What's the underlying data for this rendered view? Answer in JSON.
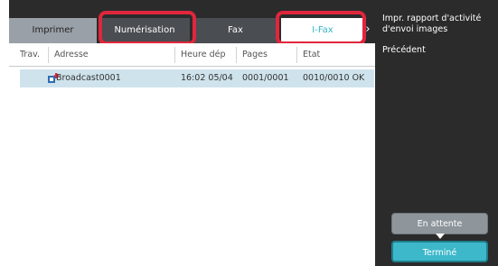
{
  "tabs": [
    {
      "label": "Imprimer"
    },
    {
      "label": "Numérisation"
    },
    {
      "label": "Fax"
    },
    {
      "label": "I-Fax"
    }
  ],
  "table": {
    "columns": [
      "Trav.",
      "Adresse",
      "Heure dép",
      "Pages",
      "Etat"
    ],
    "rows": [
      {
        "address": "Broadcast0001",
        "time": "16:02 05/04",
        "pages": "0001/0001",
        "status": "0010/0010 OK"
      }
    ]
  },
  "side": {
    "report_label": "Impr. rapport d'activité d'envoi images",
    "previous_label": "Précédent"
  },
  "buttons": {
    "waiting_label": "En attente",
    "done_label": "Terminé"
  },
  "colors": {
    "active_tab_text": "#36b4c6",
    "highlight": "#e0263c",
    "done_button": "#3db8cb",
    "row_selected": "#cfe3ec"
  },
  "icons": [
    "broadcast-job-icon",
    "chevron-right-icon"
  ]
}
